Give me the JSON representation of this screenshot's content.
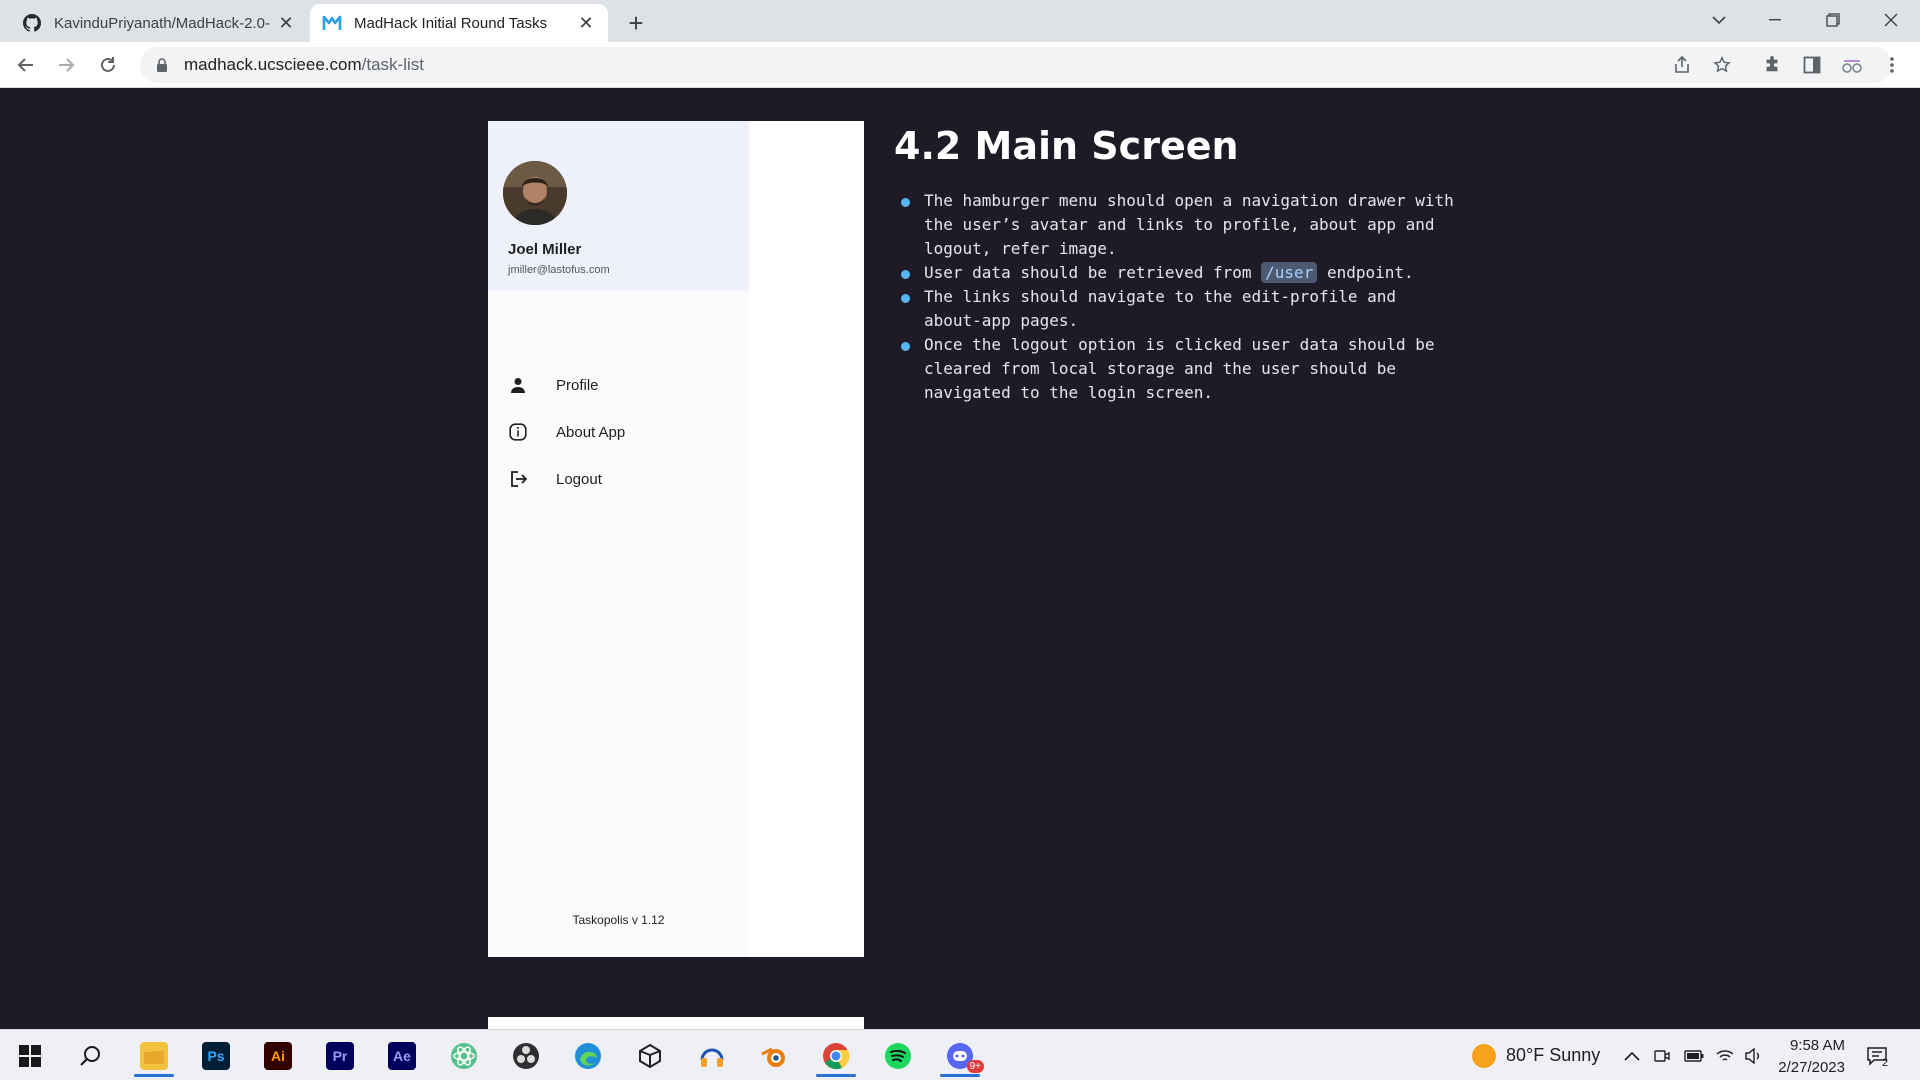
{
  "browser": {
    "tabs": [
      {
        "title": "KavinduPriyanath/MadHack-2.0-",
        "favicon": "github-icon",
        "active": false
      },
      {
        "title": "MadHack Initial Round Tasks",
        "favicon": "madhack-logo-icon",
        "active": true
      }
    ],
    "url_host": "madhack.ucscieee.com",
    "url_path": "/task-list"
  },
  "drawer": {
    "user_name": "Joel Miller",
    "user_email": "jmiller@lastofus.com",
    "menu": [
      {
        "label": "Profile",
        "icon": "person-icon"
      },
      {
        "label": "About App",
        "icon": "info-icon"
      },
      {
        "label": "Logout",
        "icon": "logout-icon"
      }
    ],
    "version": "Taskopolis v 1.12"
  },
  "section": {
    "heading": "4.2 Main Screen",
    "bullets": [
      {
        "text": "The hamburger menu should open a navigation drawer with the user’s avatar and links to profile, about app and logout, refer image."
      },
      {
        "before": "User data should be retrieved from ",
        "code": "/user",
        "after": " endpoint."
      },
      {
        "text": "The links should navigate to the edit-profile and about-app pages."
      },
      {
        "text": "Once the logout option is clicked user data should be cleared from local storage and the user should be navigated to the login screen."
      }
    ],
    "accent_color": "#56b6f0"
  },
  "taskbar": {
    "apps": [
      "windows-start-icon",
      "search-icon",
      "file-explorer-icon",
      "photoshop-icon",
      "illustrator-icon",
      "premiere-pro-icon",
      "after-effects-icon",
      "atom-icon",
      "obs-icon",
      "edge-icon",
      "unity-icon",
      "audacity-icon",
      "blender-icon",
      "chrome-icon",
      "spotify-icon",
      "discord-icon"
    ],
    "app_labels": {
      "ps": "Ps",
      "ai": "Ai",
      "pr": "Pr",
      "ae": "Ae",
      "discord_badge": "9+"
    },
    "weather": "80°F  Sunny",
    "time": "9:58 AM",
    "date": "2/27/2023",
    "notifications": "2"
  }
}
